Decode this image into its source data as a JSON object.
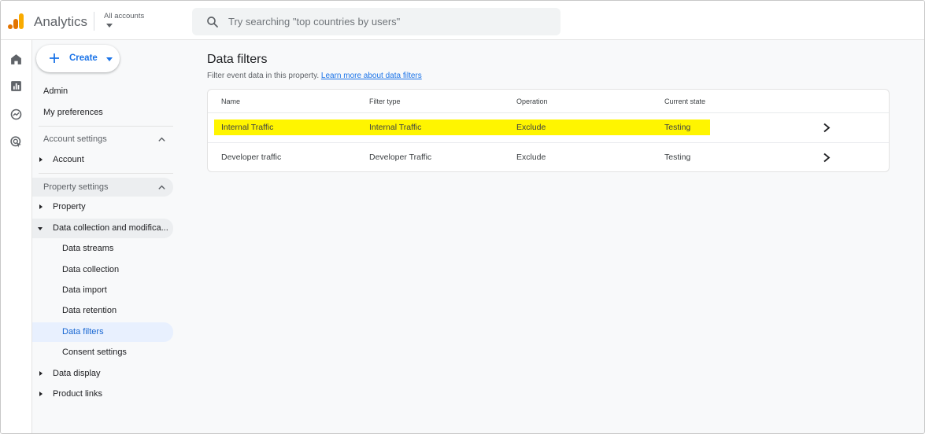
{
  "app": {
    "title": "Analytics",
    "account_selector": "All accounts"
  },
  "search": {
    "placeholder": "Try searching \"top countries by users\""
  },
  "rail": {
    "icons": [
      "home-icon",
      "reports-icon",
      "explore-icon",
      "advertising-icon"
    ]
  },
  "sidebar": {
    "create_label": "Create",
    "admin": "Admin",
    "preferences": "My preferences",
    "account_settings": "Account settings",
    "account": "Account",
    "property_settings": "Property settings",
    "property": "Property",
    "data_collection": "Data collection and modifica...",
    "sub_items": [
      "Data streams",
      "Data collection",
      "Data import",
      "Data retention",
      "Data filters",
      "Consent settings"
    ],
    "data_display": "Data display",
    "product_links": "Product links"
  },
  "main": {
    "title": "Data filters",
    "description": "Filter event data in this property.",
    "learn_more": "Learn more about data filters",
    "columns": [
      "Name",
      "Filter type",
      "Operation",
      "Current state"
    ],
    "rows": [
      {
        "name": "Internal Traffic",
        "filter_type": "Internal Traffic",
        "operation": "Exclude",
        "state": "Testing",
        "highlighted": true
      },
      {
        "name": "Developer traffic",
        "filter_type": "Developer Traffic",
        "operation": "Exclude",
        "state": "Testing",
        "highlighted": false
      }
    ]
  },
  "colors": {
    "accent": "#1a73e8",
    "highlight": "#fff500",
    "logo_orange": "#f9ab00",
    "logo_dark": "#e37400"
  }
}
